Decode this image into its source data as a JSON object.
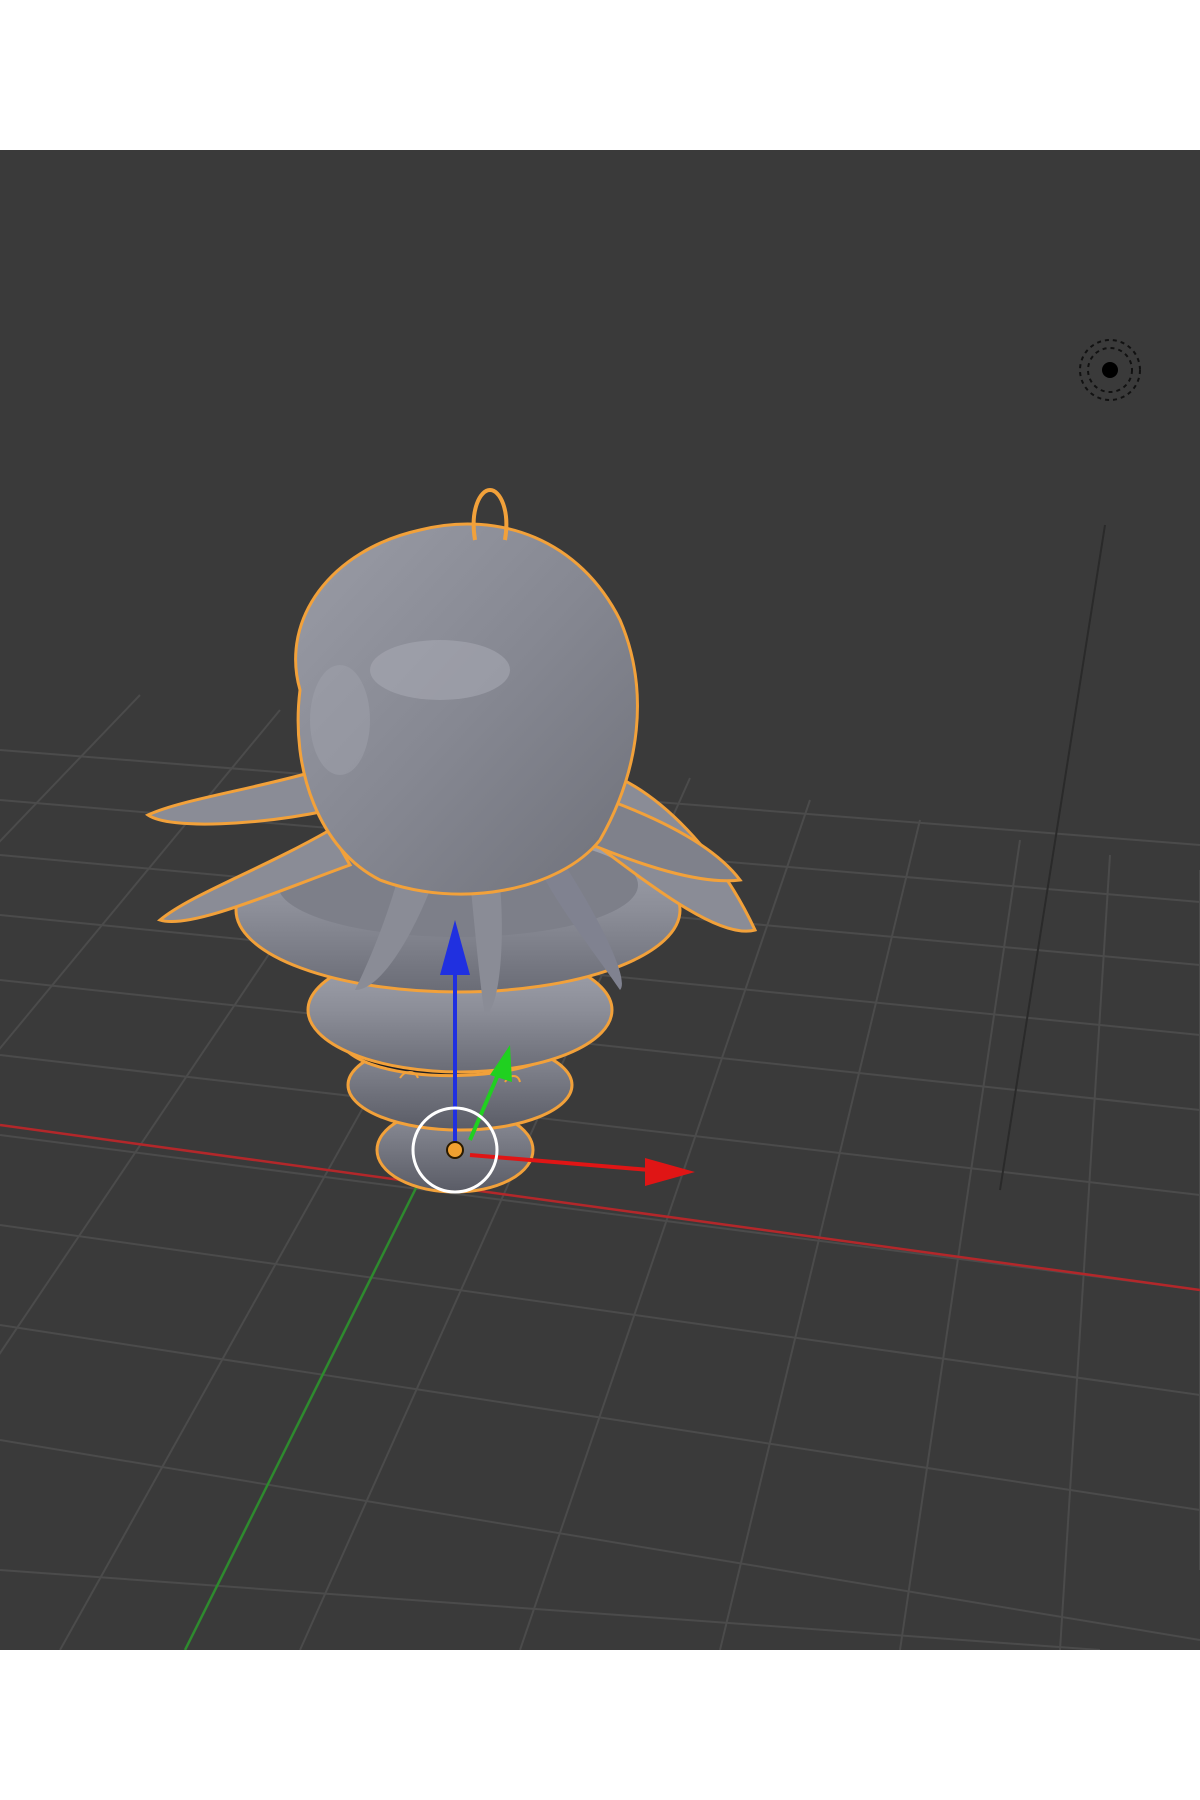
{
  "viewport": {
    "background_color": "#3a3a3a",
    "grid_color": "#4b4b4b",
    "axis_x_color": "#b3272a",
    "axis_y_color": "#2e8a2e",
    "selection_outline_color": "#f2a13a",
    "mesh_color": "#8a8c94"
  },
  "gizmo": {
    "z_arrow_color": "#2030e0",
    "y_arrow_color": "#20d020",
    "x_arrow_color": "#e01515",
    "ring_color": "#ffffff",
    "pivot_color": "#f0a030"
  },
  "icons": {
    "lamp": "lamp-icon",
    "transform_gizmo": "transform-gizmo-icon",
    "object_origin": "origin-icon"
  }
}
